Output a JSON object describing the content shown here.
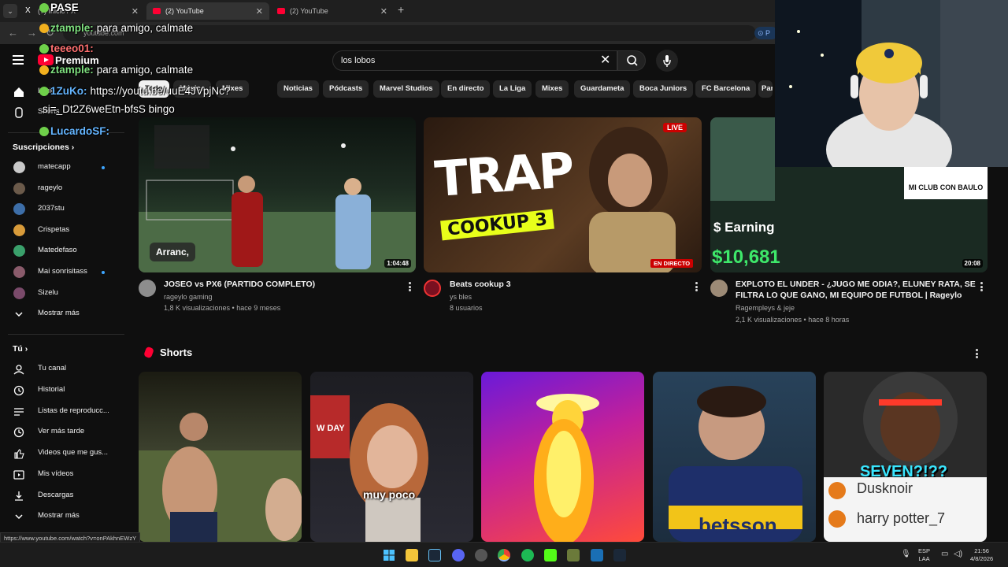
{
  "browser": {
    "tabs": [
      {
        "title": "(7) Inicio / X",
        "active": false
      },
      {
        "title": "(2) YouTube",
        "active": true
      },
      {
        "title": "(2) YouTube",
        "active": false
      }
    ],
    "address": "youtube.com",
    "new_tab": "+",
    "tab_list": "⌄"
  },
  "masthead": {
    "brand": "Premium",
    "search_value": "los lobos"
  },
  "chips": [
    "Todo",
    "Música",
    "Mixes",
    "Noticias",
    "Pódcasts",
    "Marvel Studios",
    "En directo",
    "La Liga",
    "Mixes",
    "Guardameta",
    "Boca Juniors",
    "FC Barcelona",
    "Par"
  ],
  "sidebar": {
    "home": "Inicio",
    "shorts": "Shorts",
    "subs_header": "Suscripciones",
    "subscriptions": [
      {
        "name": "matecapp",
        "color": "#c9c9c9",
        "dot": true
      },
      {
        "name": "rageylo",
        "color": "#6b5a4a",
        "dot": false
      },
      {
        "name": "2037stu",
        "color": "#3d6ea8",
        "dot": false
      },
      {
        "name": "Crispetas",
        "color": "#d89b3a",
        "dot": false
      },
      {
        "name": "Matedefaso",
        "color": "#3aa06b",
        "dot": false
      },
      {
        "name": "Mai sonrisitass",
        "color": "#8a5b6b",
        "dot": true
      },
      {
        "name": "Sizelu",
        "color": "#7a4a6a",
        "dot": false
      }
    ],
    "show_more_1": "Mostrar más",
    "you_header": "Tú",
    "you_items": [
      {
        "label": "Tu canal",
        "icon": "channel-icon"
      },
      {
        "label": "Historial",
        "icon": "history-icon"
      },
      {
        "label": "Listas de reproducc...",
        "icon": "playlists-icon"
      },
      {
        "label": "Ver más tarde",
        "icon": "watch-later-icon"
      },
      {
        "label": "Videos que me gus...",
        "icon": "like-icon"
      },
      {
        "label": "Mis vídeos",
        "icon": "my-videos-icon"
      },
      {
        "label": "Descargas",
        "icon": "downloads-icon"
      }
    ],
    "show_more_2": "Mostrar más"
  },
  "videos": [
    {
      "title": "JOSEO vs PX6 (PARTIDO COMPLETO)",
      "channel": "rageylo gaming",
      "meta": "1,8 K visualizaciones • hace 9 meses",
      "duration": "1:04:48",
      "overlay_text": "Arranc,"
    },
    {
      "title": "Beats cookup 3",
      "channel": "ys bles",
      "meta": "8 usuarios",
      "live": "LIVE",
      "live_badge": "EN DIRECTO",
      "thumb_text_1": "TRAP",
      "thumb_text_2": "COOKUP 3"
    },
    {
      "title_line1": "EXPLOTO EL UNDER - ¿JUGO ME ODIA?, ELUNEY RATA, SE",
      "title_line2": "FILTRA LO QUE GANO, MI EQUIPO DE FUTBOL | Rageylo",
      "channel": "Ragempleys & jeje",
      "meta": "2,1 K visualizaciones • hace 8 horas",
      "duration": "20:08",
      "thumb_text_1": "$ Earning",
      "thumb_text_2": "$10,681",
      "thumb_text_3": "MI CLUB CON BAULO"
    }
  ],
  "shorts": {
    "title": "Shorts",
    "captions": [
      "",
      "muy poco",
      "",
      "",
      "SEVEN?!??"
    ],
    "short5_lines": [
      "Dusknoir",
      "harry potter_7"
    ],
    "short2_text": "W DAY"
  },
  "chat": [
    {
      "user": "PASE",
      "msg": ""
    },
    {
      "user": "ztample:",
      "msg": "para amigo, calmate"
    },
    {
      "user": "teeeo01:",
      "msg": ""
    },
    {
      "user": "ztample:",
      "msg": "para amigo, calmate"
    },
    {
      "user": "1ZuKo:",
      "msg": "https://youtu.be/uuE4JVpjNc?"
    },
    {
      "user": "",
      "msg": "si=_Dt2Z6weEtn-bfsS bingo"
    },
    {
      "user": "LucardoSF:",
      "msg": ""
    }
  ],
  "status_url": "https://www.youtube.com/watch?v=onPAkhnEWzY",
  "taskbar": {
    "lang_1": "ESP",
    "lang_2": "LAA",
    "time": "21:56",
    "date": "4/8/2026"
  },
  "colors": {
    "youtube_red": "#ff0033",
    "background": "#0f0f0f",
    "chip_bg": "#272727",
    "link_blue": "#3ea6ff"
  }
}
